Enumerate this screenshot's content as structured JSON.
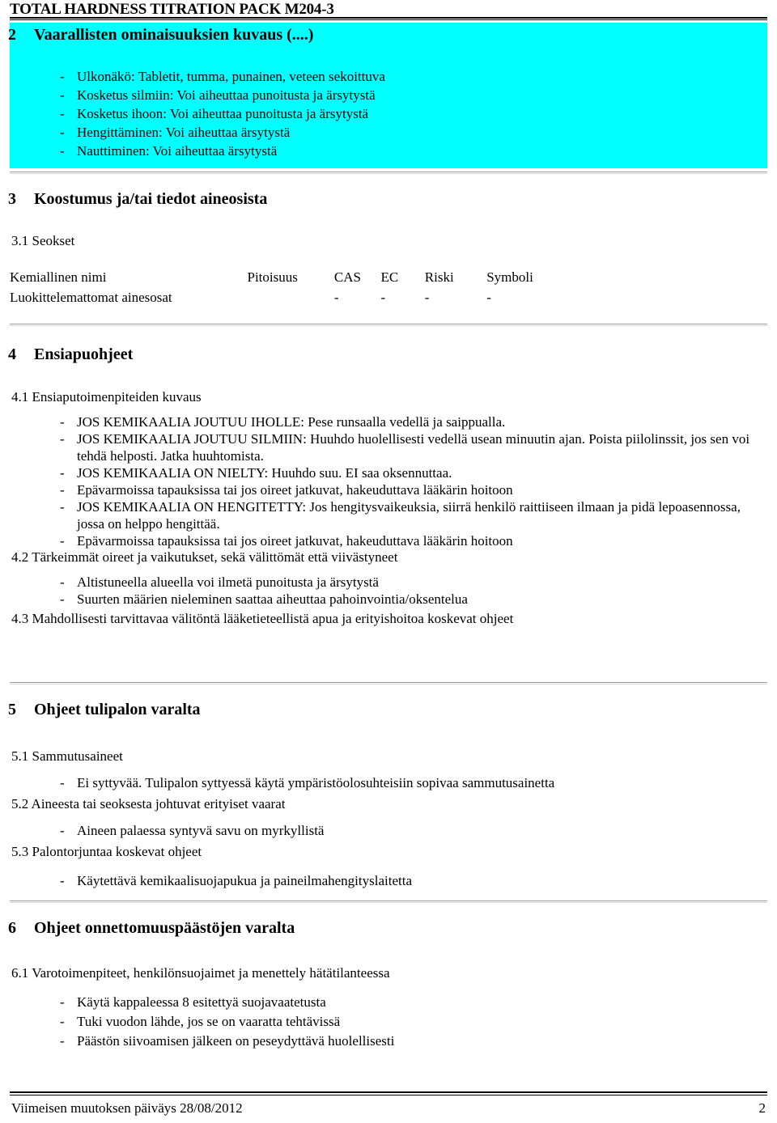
{
  "document": {
    "running_header": "TOTAL HARDNESS TITRATION PACK M204-3",
    "colors": {
      "highlight": "#00FFFF",
      "text": "#000000",
      "rule_gray": "#9A9A9A"
    }
  },
  "section2": {
    "number": "2",
    "title": "Vaarallisten ominaisuuksien kuvaus (....)",
    "bullets": [
      "Ulkonäkö: Tabletit, tumma, punainen, veteen sekoittuva",
      "Kosketus silmiin: Voi aiheuttaa punoitusta ja ärsytystä",
      "Kosketus ihoon: Voi aiheuttaa punoitusta ja ärsytystä",
      "Hengittäminen: Voi aiheuttaa ärsytystä",
      "Nauttiminen: Voi aiheuttaa ärsytystä"
    ]
  },
  "section3": {
    "number": "3",
    "title": "Koostumus ja/tai tiedot aineosista",
    "sub_3_1": "3.1 Seokset",
    "table": {
      "headers": [
        "Kemiallinen nimi",
        "Pitoisuus",
        "CAS",
        "EC",
        "Riski",
        "Symboli"
      ],
      "rows": [
        [
          "Luokittelemattomat ainesosat",
          "",
          "-",
          "-",
          "-",
          "-"
        ]
      ]
    }
  },
  "section4": {
    "number": "4",
    "title": "Ensiapuohjeet",
    "sub_4_1": "4.1 Ensiaputoimenpiteiden kuvaus",
    "bullets_4_1": [
      "JOS KEMIKAALIA JOUTUU IHOLLE: Pese runsaalla vedellä ja saippualla.",
      "JOS KEMIKAALIA JOUTUU SILMIIN: Huuhdo huolellisesti vedellä usean minuutin ajan. Poista piilolinssit, jos sen voi tehdä helposti. Jatka huuhtomista.",
      "JOS KEMIKAALIA ON NIELTY: Huuhdo suu. EI saa oksennuttaa.",
      "Epävarmoissa tapauksissa tai jos oireet jatkuvat, hakeuduttava lääkärin hoitoon",
      "JOS KEMIKAALIA ON HENGITETTY: Jos hengitysvaikeuksia, siirrä henkilö raittiiseen ilmaan ja pidä lepoasennossa, jossa on helppo hengittää.",
      "Epävarmoissa tapauksissa tai jos oireet jatkuvat, hakeuduttava lääkärin hoitoon"
    ],
    "sub_4_2": "4.2 Tärkeimmät oireet ja vaikutukset, sekä välittömät että viivästyneet",
    "bullets_4_2": [
      "Altistuneella alueella voi ilmetä punoitusta ja ärsytystä",
      "Suurten määrien nieleminen saattaa aiheuttaa pahoinvointia/oksentelua"
    ],
    "sub_4_3": "4.3 Mahdollisesti tarvittavaa välitöntä lääketieteellistä apua ja erityishoitoa koskevat ohjeet"
  },
  "section5": {
    "number": "5",
    "title": "Ohjeet tulipalon varalta",
    "sub_5_1": "5.1 Sammutusaineet",
    "bullets_5_1": [
      "Ei syttyvää. Tulipalon syttyessä käytä ympäristöolosuhteisiin sopivaa sammutusainetta"
    ],
    "sub_5_2": "5.2 Aineesta tai seoksesta johtuvat erityiset vaarat",
    "bullets_5_2": [
      "Aineen palaessa syntyvä savu on myrkyllistä"
    ],
    "sub_5_3": "5.3 Palontorjuntaa koskevat ohjeet",
    "bullets_5_3": [
      "Käytettävä kemikaalisuojapukua ja paineilmahengityslaitetta"
    ]
  },
  "section6": {
    "number": "6",
    "title": "Ohjeet onnettomuuspäästöjen varalta",
    "sub_6_1": "6.1 Varotoimenpiteet, henkilönsuojaimet ja menettely hätätilanteessa",
    "bullets_6_1": [
      "Käytä kappaleessa 8 esitettyä suojavaatetusta",
      "Tuki vuodon lähde, jos se on vaaratta tehtävissä",
      "Päästön siivoamisen jälkeen on peseydyttävä huolellisesti"
    ]
  },
  "footer": {
    "revision_label": "Viimeisen muutoksen päiväys  28/08/2012",
    "page_number": "2"
  }
}
